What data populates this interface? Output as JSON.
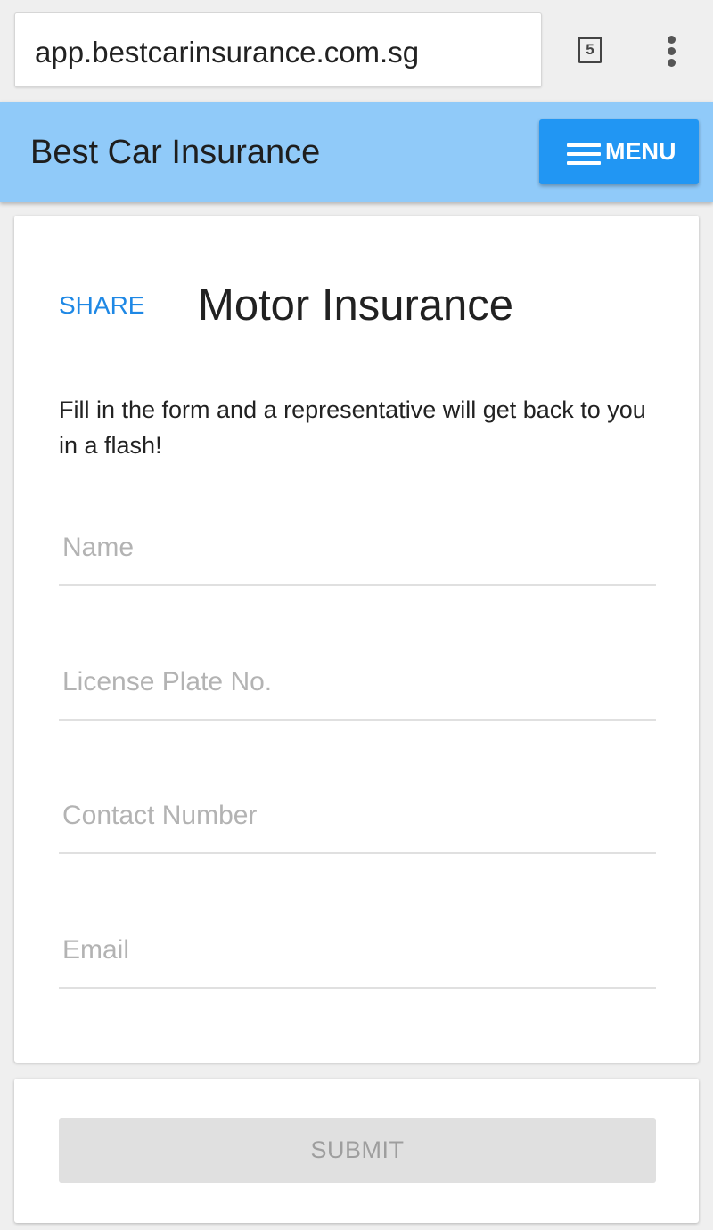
{
  "browser": {
    "url": "app.bestcarinsurance.com.sg",
    "tab_count": "5",
    "icons": {
      "tabs": "tab-switcher-icon",
      "overflow": "more-vert-icon"
    }
  },
  "header": {
    "title": "Best Car Insurance",
    "menu_label": "MENU",
    "menu_icon": "hamburger-icon"
  },
  "form": {
    "share_label": "SHARE",
    "title": "Motor Insurance",
    "description": "Fill in the form and a representative will get back to you in a flash!",
    "fields": [
      {
        "placeholder": "Name",
        "value": ""
      },
      {
        "placeholder": "License Plate No.",
        "value": ""
      },
      {
        "placeholder": "Contact Number",
        "value": ""
      },
      {
        "placeholder": "Email",
        "value": ""
      }
    ]
  },
  "submit": {
    "label": "SUBMIT",
    "state": "disabled"
  },
  "colors": {
    "header_bg": "#90caf9",
    "accent": "#2196f3",
    "link": "#1e88e5",
    "disabled_button": "#e0e0e0",
    "page_bg": "#efefef"
  }
}
